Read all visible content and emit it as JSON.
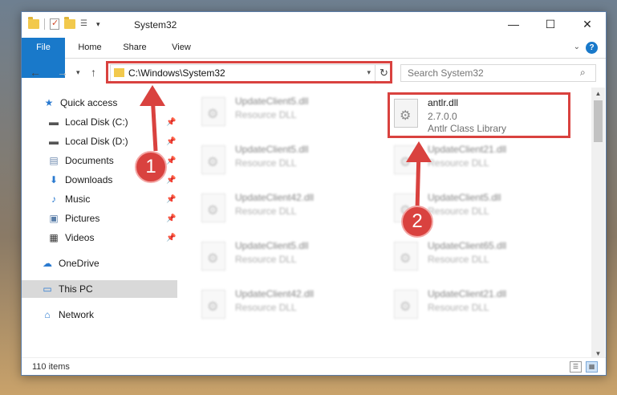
{
  "window": {
    "title": "System32",
    "controls": {
      "minimize": "—",
      "maximize": "☐",
      "close": "✕"
    }
  },
  "ribbon": {
    "tabs": [
      "File",
      "Home",
      "Share",
      "View"
    ],
    "help": "?"
  },
  "address": {
    "path": "C:\\Windows\\System32",
    "search_placeholder": "Search System32"
  },
  "sidebar": {
    "items": [
      {
        "label": "Quick access",
        "icon": "star-icon",
        "pinned": false
      },
      {
        "label": "Local Disk (C:)",
        "icon": "drive-icon",
        "pinned": true
      },
      {
        "label": "Local Disk (D:)",
        "icon": "drive-icon",
        "pinned": true
      },
      {
        "label": "Documents",
        "icon": "documents-icon",
        "pinned": true
      },
      {
        "label": "Downloads",
        "icon": "download-icon",
        "pinned": true
      },
      {
        "label": "Music",
        "icon": "music-icon",
        "pinned": true
      },
      {
        "label": "Pictures",
        "icon": "pictures-icon",
        "pinned": true
      },
      {
        "label": "Videos",
        "icon": "videos-icon",
        "pinned": true
      },
      {
        "label": "OneDrive",
        "icon": "cloud-icon",
        "pinned": false
      },
      {
        "label": "This PC",
        "icon": "computer-icon",
        "pinned": false,
        "selected": true
      },
      {
        "label": "Network",
        "icon": "network-icon",
        "pinned": false
      }
    ]
  },
  "files": {
    "highlighted": {
      "name": "antlr.dll",
      "version": "2.7.0.0",
      "description": "Antlr Class Library"
    },
    "left_column": [
      {
        "name": "UpdateClient5.dll",
        "desc": "Resource DLL"
      },
      {
        "name": "UpdateClient5.dll",
        "desc": "Resource DLL"
      },
      {
        "name": "UpdateClient42.dll",
        "desc": "Resource DLL"
      },
      {
        "name": "UpdateClient5.dll",
        "desc": "Resource DLL"
      },
      {
        "name": "UpdateClient42.dll",
        "desc": "Resource DLL"
      }
    ],
    "right_column": [
      {
        "name": "UpdateClient21.dll",
        "desc": "Resource DLL"
      },
      {
        "name": "UpdateClient5.dll",
        "desc": "Resource DLL"
      },
      {
        "name": "UpdateClient65.dll",
        "desc": "Resource DLL"
      },
      {
        "name": "UpdateClient21.dll",
        "desc": "Resource DLL"
      }
    ]
  },
  "status": {
    "count": "110 items"
  },
  "annotations": {
    "step1": "1",
    "step2": "2",
    "color": "#d9423f"
  }
}
